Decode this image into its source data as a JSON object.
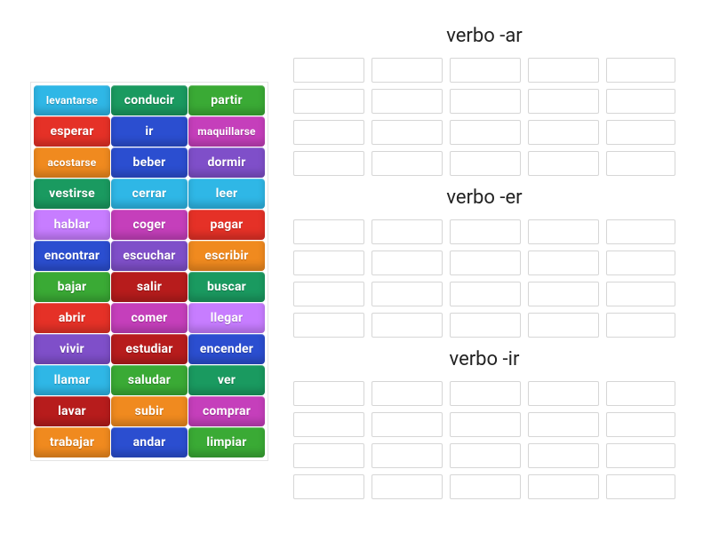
{
  "colors": {
    "cyan": "#2fb7e6",
    "teal": "#1a9a60",
    "green": "#3aaa35",
    "red": "#e53127",
    "blue": "#2b4ed0",
    "magenta": "#c53fbb",
    "orange": "#f08a1f",
    "purple": "#7f4fc9",
    "lilac": "#c77dff",
    "crimson": "#b71c1c"
  },
  "tiles": [
    [
      {
        "label": "levantarse",
        "color": "cyan",
        "small": true
      },
      {
        "label": "conducir",
        "color": "teal"
      },
      {
        "label": "partir",
        "color": "green"
      }
    ],
    [
      {
        "label": "esperar",
        "color": "red"
      },
      {
        "label": "ir",
        "color": "blue"
      },
      {
        "label": "maquillarse",
        "color": "magenta",
        "small": true
      }
    ],
    [
      {
        "label": "acostarse",
        "color": "orange",
        "small": true
      },
      {
        "label": "beber",
        "color": "blue"
      },
      {
        "label": "dormir",
        "color": "purple"
      }
    ],
    [
      {
        "label": "vestirse",
        "color": "teal"
      },
      {
        "label": "cerrar",
        "color": "cyan"
      },
      {
        "label": "leer",
        "color": "cyan"
      }
    ],
    [
      {
        "label": "hablar",
        "color": "lilac"
      },
      {
        "label": "coger",
        "color": "magenta"
      },
      {
        "label": "pagar",
        "color": "red"
      }
    ],
    [
      {
        "label": "encontrar",
        "color": "blue"
      },
      {
        "label": "escuchar",
        "color": "purple"
      },
      {
        "label": "escribir",
        "color": "orange"
      }
    ],
    [
      {
        "label": "bajar",
        "color": "green"
      },
      {
        "label": "salir",
        "color": "crimson"
      },
      {
        "label": "buscar",
        "color": "teal"
      }
    ],
    [
      {
        "label": "abrir",
        "color": "red"
      },
      {
        "label": "comer",
        "color": "magenta"
      },
      {
        "label": "llegar",
        "color": "lilac"
      }
    ],
    [
      {
        "label": "vivir",
        "color": "purple"
      },
      {
        "label": "estudiar",
        "color": "crimson"
      },
      {
        "label": "encender",
        "color": "blue"
      }
    ],
    [
      {
        "label": "llamar",
        "color": "cyan"
      },
      {
        "label": "saludar",
        "color": "green"
      },
      {
        "label": "ver",
        "color": "teal"
      }
    ],
    [
      {
        "label": "lavar",
        "color": "crimson"
      },
      {
        "label": "subir",
        "color": "orange"
      },
      {
        "label": "comprar",
        "color": "magenta"
      }
    ],
    [
      {
        "label": "trabajar",
        "color": "orange"
      },
      {
        "label": "andar",
        "color": "blue"
      },
      {
        "label": "limpiar",
        "color": "green"
      }
    ]
  ],
  "groups": [
    {
      "title": "verbo -ar",
      "rows": 4,
      "cols": 5
    },
    {
      "title": "verbo -er",
      "rows": 4,
      "cols": 5
    },
    {
      "title": "verbo -ir",
      "rows": 4,
      "cols": 5
    }
  ]
}
